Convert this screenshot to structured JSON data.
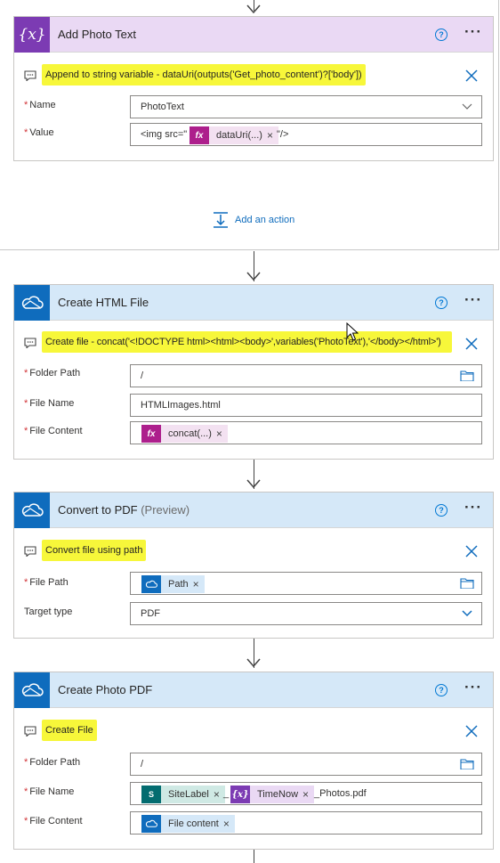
{
  "colors": {
    "variable_accent": "#7c3bb3",
    "variable_header_bg": "#ead9f4",
    "onedrive_accent": "#0f6cbd",
    "onedrive_header_bg": "#d5e8f8",
    "highlight": "#f7f73a",
    "link": "#0f6cbd",
    "required": "#d13438"
  },
  "add_action": {
    "label": "Add an action",
    "icon": "add-action-icon"
  },
  "cards": {
    "add_photo_text": {
      "title": "Add Photo Text",
      "icon": "variable-icon",
      "icon_text": "{x}",
      "comment": "Append to string variable - dataUri(outputs('Get_photo_content')?['body'])",
      "name_label": "Name",
      "name_value": "PhotoText",
      "value_label": "Value",
      "value_prefix": "<img src=\"",
      "value_token": "dataUri(...)",
      "value_suffix": "\"/>"
    },
    "create_html_file": {
      "title": "Create HTML File",
      "icon": "onedrive-icon",
      "comment": "Create file - concat('<!DOCTYPE html><html><body>',variables('PhotoText'),'</body></html>')",
      "folder_label": "Folder Path",
      "folder_value": "/",
      "file_name_label": "File Name",
      "file_name_value": "HTMLImages.html",
      "file_content_label": "File Content",
      "file_content_token": "concat(...)"
    },
    "convert_to_pdf": {
      "title": "Convert to PDF",
      "title_suffix": "(Preview)",
      "icon": "onedrive-icon",
      "comment": "Convert file using path",
      "file_path_label": "File Path",
      "file_path_token": "Path",
      "target_type_label": "Target type",
      "target_type_value": "PDF"
    },
    "create_photo_pdf": {
      "title": "Create Photo PDF",
      "icon": "onedrive-icon",
      "comment": "Create File",
      "folder_label": "Folder Path",
      "folder_value": "/",
      "file_name_label": "File Name",
      "file_name_token_1": "SiteLabel",
      "file_name_sep": "_",
      "file_name_token_2": "TimeNow",
      "file_name_suffix": "_Photos.pdf",
      "file_content_label": "File Content",
      "file_content_token": "File content"
    }
  }
}
